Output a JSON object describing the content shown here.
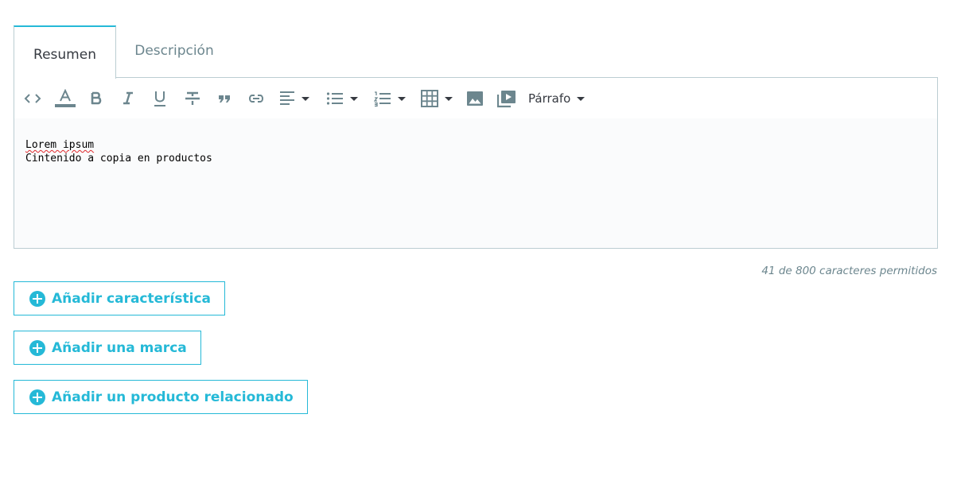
{
  "tabs": [
    {
      "label": "Resumen",
      "active": true
    },
    {
      "label": "Descripción",
      "active": false
    }
  ],
  "toolbar": {
    "icons": [
      "code-view-icon",
      "font-color-icon",
      "bold-icon",
      "italic-icon",
      "underline-icon",
      "strikethrough-icon",
      "blockquote-icon",
      "link-icon",
      "align-left-icon",
      "bullet-list-icon",
      "numbered-list-icon",
      "table-icon",
      "image-icon",
      "video-icon"
    ],
    "paragraph_label": "Párrafo"
  },
  "editor": {
    "lines": [
      "Lorem ipsum",
      "Cintenido a copia en productos"
    ]
  },
  "counter": "41 de 800 caracteres permitidos",
  "buttons": {
    "add_feature": "Añadir característica",
    "add_brand": "Añadir una marca",
    "add_related": "Añadir un producto relacionado"
  },
  "colors": {
    "accent": "#25b9d7",
    "icon": "#6c868e",
    "border": "#bbcdd2"
  }
}
